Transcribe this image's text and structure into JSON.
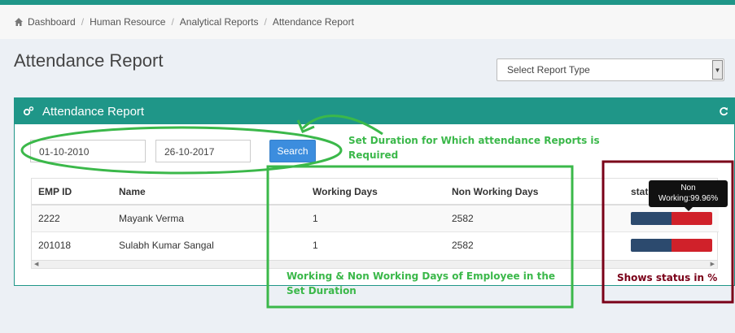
{
  "breadcrumb": {
    "items": [
      "Dashboard",
      "Human Resource",
      "Analytical Reports",
      "Attendance Report"
    ]
  },
  "page_title": "Attendance Report",
  "report_type_select": {
    "selected": "Select Report Type"
  },
  "panel": {
    "title": "Attendance Report"
  },
  "filters": {
    "from_date": "01-10-2010",
    "to_date": "26-10-2017",
    "search_label": "Search"
  },
  "table": {
    "headers": [
      "EMP ID",
      "Name",
      "Working Days",
      "Non Working Days",
      "status %"
    ],
    "rows": [
      {
        "emp_id": "2222",
        "name": "Mayank Verma",
        "working_days": "1",
        "non_working_days": "2582",
        "working_fraction": 0.5,
        "non_working_fraction": 0.5
      },
      {
        "emp_id": "201018",
        "name": "Sulabh Kumar Sangal",
        "working_days": "1",
        "non_working_days": "2582",
        "working_fraction": 0.5,
        "non_working_fraction": 0.5
      }
    ]
  },
  "tooltip": {
    "line1": "Non",
    "line2": "Working:99.96%"
  },
  "annotations": {
    "duration_note": [
      "Set Duration for Which attendance Reports is",
      "Required"
    ],
    "days_note": [
      "Working & Non Working Days of Employee in the",
      "Set Duration"
    ],
    "status_note": "Shows status in %"
  },
  "colors": {
    "header_teal": "#1f9688",
    "annotation_green": "#3bb84a",
    "annotation_maroon": "#7a0018",
    "working_bar": "#2c4a6e",
    "non_working_bar": "#d0212a"
  }
}
